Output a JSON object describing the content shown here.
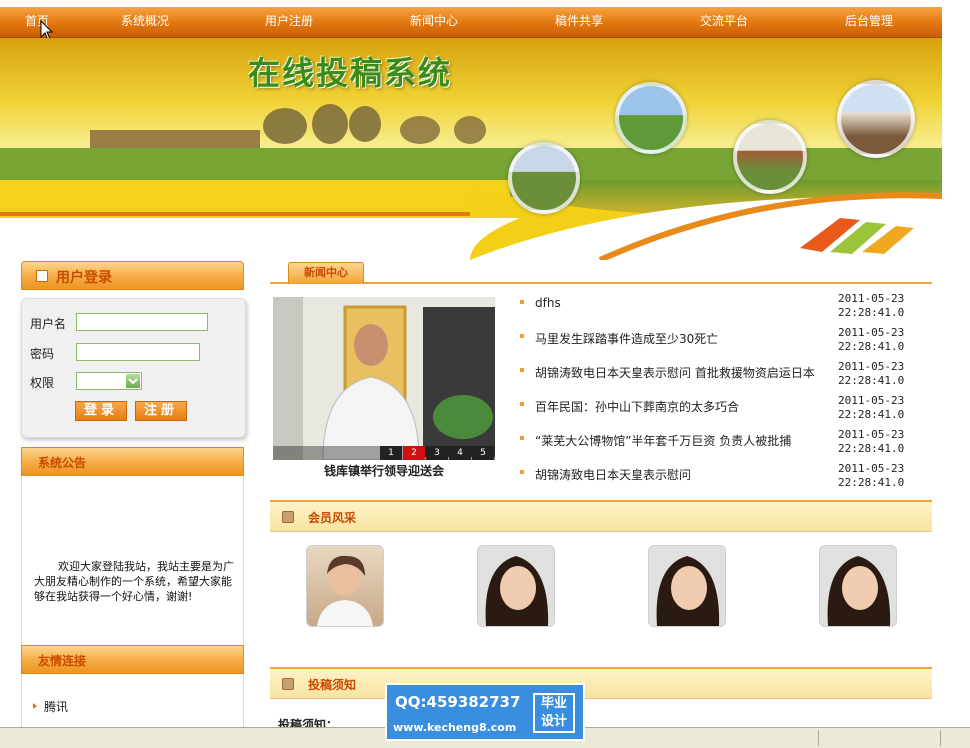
{
  "nav": {
    "items": [
      "首页",
      "系统概况",
      "用户注册",
      "新闻中心",
      "稿件共享",
      "交流平台",
      "后台管理"
    ]
  },
  "banner": {
    "title": "在线投稿系统"
  },
  "login": {
    "title": "用户登录",
    "username_label": "用户名",
    "password_label": "密码",
    "role_label": "权限",
    "login_btn": "登录",
    "register_btn": "注册"
  },
  "notice": {
    "title": "系统公告",
    "text": "欢迎大家登陆我站，我站主要是为广大朋友精心制作的一个系统，希望大家能够在我站获得一个好心情，谢谢!"
  },
  "links": {
    "title": "友情连接",
    "items": [
      "腾讯"
    ]
  },
  "news": {
    "tab": "新闻中心",
    "caption": "钱库镇举行领导迎送会",
    "slides": [
      "1",
      "2",
      "3",
      "4",
      "5"
    ],
    "active_slide": 2,
    "items": [
      {
        "title": "dfhs",
        "date": "2011-05-23",
        "time": "22:28:41.0"
      },
      {
        "title": "马里发生踩踏事件造成至少30死亡",
        "date": "2011-05-23",
        "time": "22:28:41.0"
      },
      {
        "title": "胡锦涛致电日本天皇表示慰问 首批救援物资启运日本",
        "date": "2011-05-23",
        "time": "22:28:41.0"
      },
      {
        "title": "百年民国：孙中山下葬南京的太多巧合",
        "date": "2011-05-23",
        "time": "22:28:41.0"
      },
      {
        "title": "“莱芜大公博物馆”半年套千万巨资 负责人被批捕",
        "date": "2011-05-23",
        "time": "22:28:41.0"
      },
      {
        "title": "胡锦涛致电日本天皇表示慰问",
        "date": "2011-05-23",
        "time": "22:28:41.0"
      }
    ]
  },
  "members": {
    "title": "会员风采"
  },
  "guide": {
    "title": "投稿须知",
    "text": "投稿须知："
  },
  "watermark": {
    "qq": "QQ:459382737",
    "site": "www.kecheng8.com",
    "tag1": "毕业",
    "tag2": "设计"
  },
  "colors": {
    "nav": "#e2770f",
    "accent": "#c94b00",
    "link_border": "#f0a43a"
  }
}
